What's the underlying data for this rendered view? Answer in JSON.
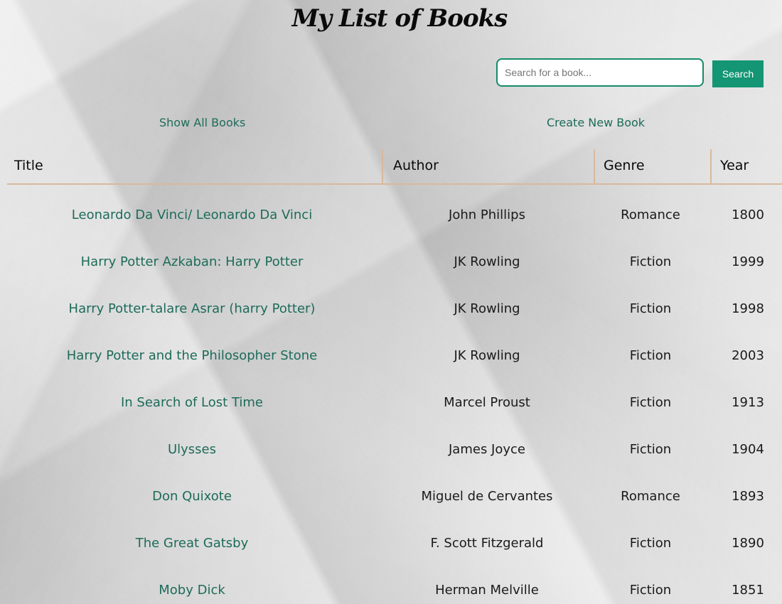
{
  "header": {
    "title": "My List of Books"
  },
  "search": {
    "placeholder": "Search for a book...",
    "value": "",
    "button_label": "Search"
  },
  "nav": {
    "show_all_label": "Show All Books",
    "create_new_label": "Create New Book"
  },
  "table": {
    "columns": [
      "Title",
      "Author",
      "Genre",
      "Year"
    ],
    "rows": [
      {
        "title": "Leonardo Da Vinci/ Leonardo Da Vinci",
        "author": "John Phillips",
        "genre": "Romance",
        "year": "1800"
      },
      {
        "title": "Harry Potter Azkaban: Harry Potter",
        "author": "JK Rowling",
        "genre": "Fiction",
        "year": "1999"
      },
      {
        "title": "Harry Potter-talare Asrar (harry Potter)",
        "author": "JK Rowling",
        "genre": "Fiction",
        "year": "1998"
      },
      {
        "title": "Harry Potter and the Philosopher Stone",
        "author": "JK Rowling",
        "genre": "Fiction",
        "year": "2003"
      },
      {
        "title": "In Search of Lost Time",
        "author": "Marcel Proust",
        "genre": "Fiction",
        "year": "1913"
      },
      {
        "title": "Ulysses",
        "author": "James Joyce",
        "genre": "Fiction",
        "year": "1904"
      },
      {
        "title": "Don Quixote",
        "author": "Miguel de Cervantes",
        "genre": "Romance",
        "year": "1893"
      },
      {
        "title": "The Great Gatsby",
        "author": "F. Scott Fitzgerald",
        "genre": "Fiction",
        "year": "1890"
      },
      {
        "title": "Moby Dick",
        "author": "Herman Melville",
        "genre": "Fiction",
        "year": "1851"
      }
    ]
  },
  "colors": {
    "accent": "#149573",
    "link": "#1d6b58",
    "table_border": "#d7b99c"
  }
}
